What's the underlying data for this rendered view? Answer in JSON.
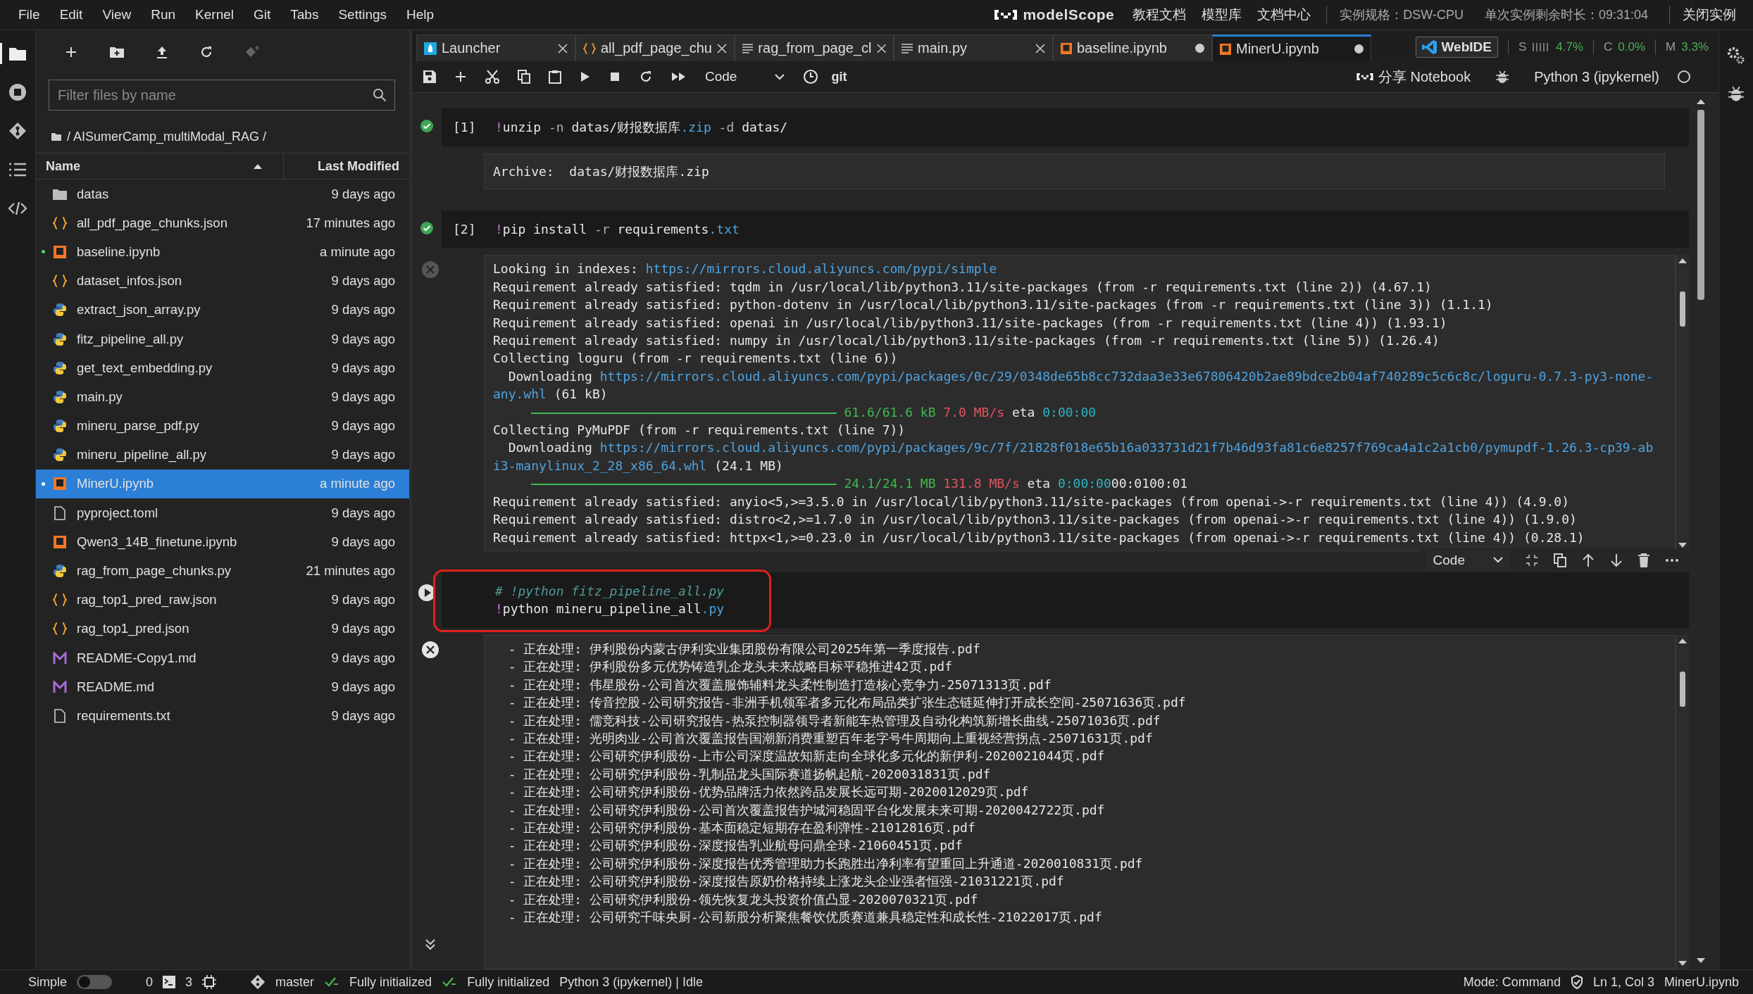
{
  "menu": [
    "File",
    "Edit",
    "View",
    "Run",
    "Kernel",
    "Git",
    "Tabs",
    "Settings",
    "Help"
  ],
  "header": {
    "logo": "modelScope",
    "links": [
      "教程文档",
      "模型库",
      "文档中心"
    ],
    "spec": "实例规格：DSW-CPU",
    "remaining": "单次实例剩余时长：09:31:04",
    "close": "关闭实例"
  },
  "activity_bar": [
    {
      "kind": "folder",
      "selected": true
    },
    {
      "kind": "running",
      "selected": false
    },
    {
      "kind": "git",
      "selected": false
    },
    {
      "kind": "toc",
      "selected": false
    },
    {
      "kind": "code",
      "selected": false
    }
  ],
  "file_browser": {
    "filter_placeholder": "Filter files by name",
    "breadcrumb": "/ AISumerCamp_multiModal_RAG /",
    "columns": [
      "Name",
      "Last Modified"
    ],
    "files": [
      {
        "name": "datas",
        "modified": "9 days ago",
        "kind": "folder",
        "selected": false,
        "running": false
      },
      {
        "name": "all_pdf_page_chunks.json",
        "modified": "17 minutes ago",
        "kind": "json",
        "selected": false,
        "running": false
      },
      {
        "name": "baseline.ipynb",
        "modified": "a minute ago",
        "kind": "notebook",
        "selected": false,
        "running": true
      },
      {
        "name": "dataset_infos.json",
        "modified": "9 days ago",
        "kind": "json",
        "selected": false,
        "running": false
      },
      {
        "name": "extract_json_array.py",
        "modified": "9 days ago",
        "kind": "python",
        "selected": false,
        "running": false
      },
      {
        "name": "fitz_pipeline_all.py",
        "modified": "9 days ago",
        "kind": "python",
        "selected": false,
        "running": false
      },
      {
        "name": "get_text_embedding.py",
        "modified": "9 days ago",
        "kind": "python",
        "selected": false,
        "running": false
      },
      {
        "name": "main.py",
        "modified": "9 days ago",
        "kind": "python",
        "selected": false,
        "running": false
      },
      {
        "name": "mineru_parse_pdf.py",
        "modified": "9 days ago",
        "kind": "python",
        "selected": false,
        "running": false
      },
      {
        "name": "mineru_pipeline_all.py",
        "modified": "9 days ago",
        "kind": "python",
        "selected": false,
        "running": false
      },
      {
        "name": "MinerU.ipynb",
        "modified": "a minute ago",
        "kind": "notebook",
        "selected": true,
        "running": true
      },
      {
        "name": "pyproject.toml",
        "modified": "9 days ago",
        "kind": "text",
        "selected": false,
        "running": false
      },
      {
        "name": "Qwen3_14B_finetune.ipynb",
        "modified": "9 days ago",
        "kind": "notebook",
        "selected": false,
        "running": false
      },
      {
        "name": "rag_from_page_chunks.py",
        "modified": "21 minutes ago",
        "kind": "python",
        "selected": false,
        "running": false
      },
      {
        "name": "rag_top1_pred_raw.json",
        "modified": "9 days ago",
        "kind": "json",
        "selected": false,
        "running": false
      },
      {
        "name": "rag_top1_pred.json",
        "modified": "9 days ago",
        "kind": "json",
        "selected": false,
        "running": false
      },
      {
        "name": "README-Copy1.md",
        "modified": "9 days ago",
        "kind": "markdown",
        "selected": false,
        "running": false
      },
      {
        "name": "README.md",
        "modified": "9 days ago",
        "kind": "markdown",
        "selected": false,
        "running": false
      },
      {
        "name": "requirements.txt",
        "modified": "9 days ago",
        "kind": "text",
        "selected": false,
        "running": false
      }
    ]
  },
  "tabs": [
    {
      "label": "Launcher",
      "kind": "launcher",
      "selected": false,
      "dirty": false
    },
    {
      "label": "all_pdf_page_chu",
      "kind": "json",
      "selected": false,
      "dirty": false
    },
    {
      "label": "rag_from_page_cl",
      "kind": "text",
      "selected": false,
      "dirty": false
    },
    {
      "label": "main.py",
      "kind": "text",
      "selected": false,
      "dirty": false
    },
    {
      "label": "baseline.ipynb",
      "kind": "notebook",
      "selected": false,
      "dirty": true
    },
    {
      "label": "MinerU.ipynb",
      "kind": "notebook",
      "selected": true,
      "dirty": true
    }
  ],
  "overlay": {
    "webide": "WebIDE",
    "metrics": [
      {
        "label": "S",
        "value": "4.7%",
        "kind": "bars"
      },
      {
        "label": "C",
        "value": "0.0%",
        "kind": "plain"
      },
      {
        "label": "M",
        "value": "3.3%",
        "kind": "plain"
      }
    ]
  },
  "toolbar": {
    "cell_type": "Code",
    "git": "git",
    "share": "分享 Notebook",
    "kernel": "Python 3 (ipykernel)",
    "kernel_busy": false
  },
  "cells": [
    {
      "prompt": "[1]",
      "executed": true,
      "highlighted": false,
      "source": [
        [
          {
            "text": "!",
            "kind": "magic"
          },
          {
            "text": "unzip ",
            "kind": "plain"
          },
          {
            "text": "-n",
            "kind": "flag"
          },
          {
            "text": " datas/财报数据库",
            "kind": "plain"
          },
          {
            "text": ".zip",
            "kind": "ext"
          },
          {
            "text": " -d",
            "kind": "flag"
          },
          {
            "text": " datas/",
            "kind": "plain"
          }
        ]
      ],
      "output": {
        "scroll": false,
        "lines": [
          [
            {
              "text": "Archive:  datas/财报数据库.zip",
              "kind": "plain"
            }
          ]
        ]
      }
    },
    {
      "prompt": "[2]",
      "executed": true,
      "highlighted": false,
      "source": [
        [
          {
            "text": "!",
            "kind": "magic"
          },
          {
            "text": "pip install ",
            "kind": "plain"
          },
          {
            "text": "-r",
            "kind": "flag"
          },
          {
            "text": " requirements",
            "kind": "plain"
          },
          {
            "text": ".txt",
            "kind": "ext"
          }
        ]
      ],
      "output": {
        "scroll": true,
        "clear_icon_active": false,
        "lines": [
          [
            {
              "text": "Looking in indexes: ",
              "kind": "plain"
            },
            {
              "text": "https://mirrors.cloud.aliyuncs.com/pypi/simple",
              "kind": "link"
            }
          ],
          [
            {
              "text": "Requirement already satisfied: tqdm in /usr/local/lib/python3.11/site-packages (from -r requirements.txt (line 2)) (4.67.1)",
              "kind": "plain"
            }
          ],
          [
            {
              "text": "Requirement already satisfied: python-dotenv in /usr/local/lib/python3.11/site-packages (from -r requirements.txt (line 3)) (1.1.1)",
              "kind": "plain"
            }
          ],
          [
            {
              "text": "Requirement already satisfied: openai in /usr/local/lib/python3.11/site-packages (from -r requirements.txt (line 4)) (1.93.1)",
              "kind": "plain"
            }
          ],
          [
            {
              "text": "Requirement already satisfied: numpy in /usr/local/lib/python3.11/site-packages (from -r requirements.txt (line 5)) (1.26.4)",
              "kind": "plain"
            }
          ],
          [
            {
              "text": "Collecting loguru (from -r requirements.txt (line 6))",
              "kind": "plain"
            }
          ],
          [
            {
              "text": "  Downloading ",
              "kind": "plain"
            },
            {
              "text": "https://mirrors.cloud.aliyuncs.com/pypi/packages/0c/29/0348de65b8cc732daa3e33e67806420b2ae89bdce2b04af740289c5c6c8c/loguru-0.7.3-py3-none-",
              "kind": "link"
            }
          ],
          [
            {
              "text": "any.whl",
              "kind": "link"
            },
            {
              "text": " (61 kB)",
              "kind": "plain"
            }
          ],
          [
            {
              "kind": "bar",
              "level": 1
            },
            {
              "text": " 61.6/61.6 kB",
              "kind": "green"
            },
            {
              "text": " 7.0 MB/s",
              "kind": "red"
            },
            {
              "text": " eta ",
              "kind": "plain"
            },
            {
              "text": "0:00:00",
              "kind": "cyan"
            }
          ],
          [
            {
              "text": "Collecting PyMuPDF (from -r requirements.txt (line 7))",
              "kind": "plain"
            }
          ],
          [
            {
              "text": "  Downloading ",
              "kind": "plain"
            },
            {
              "text": "https://mirrors.cloud.aliyuncs.com/pypi/packages/9c/7f/21828f018e65b16a033731d21f7b46d93fa81c6e8257f769ca4a1c2a1cb0/pymupdf-1.26.3-cp39-ab",
              "kind": "link"
            }
          ],
          [
            {
              "text": "i3-manylinux_2_28_x86_64.whl",
              "kind": "link"
            },
            {
              "text": " (24.1 MB)",
              "kind": "plain"
            }
          ],
          [
            {
              "kind": "bar",
              "level": 1
            },
            {
              "text": " 24.1/24.1 MB",
              "kind": "green"
            },
            {
              "text": " 131.8 MB/s",
              "kind": "red"
            },
            {
              "text": " eta ",
              "kind": "plain"
            },
            {
              "text": "0:00:00",
              "kind": "cyan"
            },
            {
              "text": "00:0100:01",
              "kind": "plain"
            }
          ],
          [
            {
              "text": "Requirement already satisfied: anyio<5,>=3.5.0 in /usr/local/lib/python3.11/site-packages (from openai->-r requirements.txt (line 4)) (4.9.0)",
              "kind": "plain"
            }
          ],
          [
            {
              "text": "Requirement already satisfied: distro<2,>=1.7.0 in /usr/local/lib/python3.11/site-packages (from openai->-r requirements.txt (line 4)) (1.9.0)",
              "kind": "plain"
            }
          ],
          [
            {
              "text": "Requirement already satisfied: httpx<1,>=0.23.0 in /usr/local/lib/python3.11/site-packages (from openai->-r requirements.txt (line 4)) (0.28.1)",
              "kind": "plain"
            }
          ]
        ]
      }
    },
    {
      "executed": false,
      "highlighted": true,
      "source": [
        [
          {
            "text": "# !python fitz_pipeline_all.py",
            "kind": "comment"
          }
        ],
        [
          {
            "text": "!",
            "kind": "magic"
          },
          {
            "text": "python mineru_pipeline_all",
            "kind": "plain"
          },
          {
            "text": ".py",
            "kind": "ext"
          }
        ]
      ],
      "output": {
        "scroll": true,
        "clear_icon_active": true,
        "collapse_icon": true,
        "lines": [
          [
            {
              "text": "  - 正在处理: 伊利股份内蒙古伊利实业集团股份有限公司2025年第一季度报告.pdf",
              "kind": "plain"
            }
          ],
          [
            {
              "text": "  - 正在处理: 伊利股份多元优势铸造乳企龙头未来战略目标平稳推进42页.pdf",
              "kind": "plain"
            }
          ],
          [
            {
              "text": "  - 正在处理: 伟星股份-公司首次覆盖服饰辅料龙头柔性制造打造核心竞争力-25071313页.pdf",
              "kind": "plain"
            }
          ],
          [
            {
              "text": "  - 正在处理: 传音控股-公司研究报告-非洲手机领军者多元化布局品类扩张生态链延伸打开成长空间-25071636页.pdf",
              "kind": "plain"
            }
          ],
          [
            {
              "text": "  - 正在处理: 儒竞科技-公司研究报告-热泵控制器领导者新能车热管理及自动化构筑新增长曲线-25071036页.pdf",
              "kind": "plain"
            }
          ],
          [
            {
              "text": "  - 正在处理: 光明肉业-公司首次覆盖报告国潮新消费重塑百年老字号牛周期向上重视经营拐点-25071631页.pdf",
              "kind": "plain"
            }
          ],
          [
            {
              "text": "  - 正在处理: 公司研究伊利股份-上市公司深度温故知新走向全球化多元化的新伊利-2020021044页.pdf",
              "kind": "plain"
            }
          ],
          [
            {
              "text": "  - 正在处理: 公司研究伊利股份-乳制品龙头国际赛道扬帆起航-2020031831页.pdf",
              "kind": "plain"
            }
          ],
          [
            {
              "text": "  - 正在处理: 公司研究伊利股份-优势品牌活力依然跨品发展长远可期-2020012029页.pdf",
              "kind": "plain"
            }
          ],
          [
            {
              "text": "  - 正在处理: 公司研究伊利股份-公司首次覆盖报告护城河稳固平台化发展未来可期-2020042722页.pdf",
              "kind": "plain"
            }
          ],
          [
            {
              "text": "  - 正在处理: 公司研究伊利股份-基本面稳定短期存在盈利弹性-21012816页.pdf",
              "kind": "plain"
            }
          ],
          [
            {
              "text": "  - 正在处理: 公司研究伊利股份-深度报告乳业航母问鼎全球-21060451页.pdf",
              "kind": "plain"
            }
          ],
          [
            {
              "text": "  - 正在处理: 公司研究伊利股份-深度报告优秀管理助力长跑胜出净利率有望重回上升通道-2020010831页.pdf",
              "kind": "plain"
            }
          ],
          [
            {
              "text": "  - 正在处理: 公司研究伊利股份-深度报告原奶价格持续上涨龙头企业强者恒强-21031221页.pdf",
              "kind": "plain"
            }
          ],
          [
            {
              "text": "  - 正在处理: 公司研究伊利股份-领先恢复龙头投资价值凸显-2020070321页.pdf",
              "kind": "plain"
            }
          ],
          [
            {
              "text": "  - 正在处理: 公司研究千味央厨-公司新股分析聚焦餐饮优质赛道兼具稳定性和成长性-21022017页.pdf",
              "kind": "plain"
            }
          ]
        ]
      }
    }
  ],
  "cell_toolbar": {
    "cell_type": "Code"
  },
  "status_bar": {
    "simple_label": "Simple",
    "simple": false,
    "terminals": "0",
    "kernels": "3",
    "branch": "master",
    "git_status": "Fully initialized",
    "lsp_status": "Fully initialized",
    "kernel_status": "Python 3 (ipykernel) | Idle",
    "mode": "Mode: Command",
    "position": "Ln 1, Col 3",
    "file": "MinerU.ipynb"
  }
}
